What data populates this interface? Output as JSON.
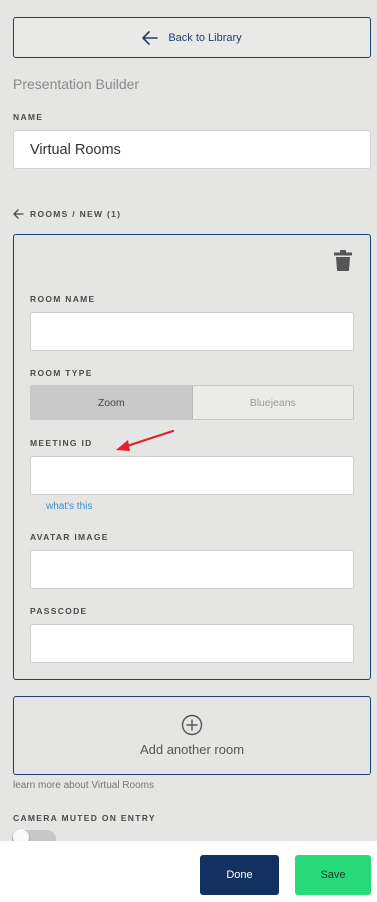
{
  "header": {
    "back_label": "Back to Library",
    "page_title": "Presentation Builder"
  },
  "name_section": {
    "label": "NAME",
    "value": "Virtual Rooms"
  },
  "breadcrumb": {
    "text": "ROOMS / NEW (1)"
  },
  "room": {
    "room_name_label": "ROOM NAME",
    "room_name_value": "",
    "room_type_label": "ROOM TYPE",
    "room_type_options": [
      "Zoom",
      "Bluejeans"
    ],
    "room_type_selected": "Zoom",
    "meeting_id_label": "MEETING ID",
    "meeting_id_value": "",
    "whats_this": "what's this",
    "avatar_label": "AVATAR IMAGE",
    "avatar_value": "",
    "passcode_label": "PASSCODE",
    "passcode_value": ""
  },
  "add_room": {
    "label": "Add another room",
    "icon": "plus-circle-icon"
  },
  "learn_more": "learn more about Virtual Rooms",
  "camera": {
    "label": "CAMERA MUTED ON ENTRY",
    "enabled": false
  },
  "footer": {
    "done_label": "Done",
    "save_label": "Save"
  },
  "colors": {
    "navy": "#1f3f6e",
    "done_bg": "#123060",
    "save_bg": "#28db7a",
    "link": "#3d8fc8",
    "annotation_arrow": "#e0202a"
  }
}
